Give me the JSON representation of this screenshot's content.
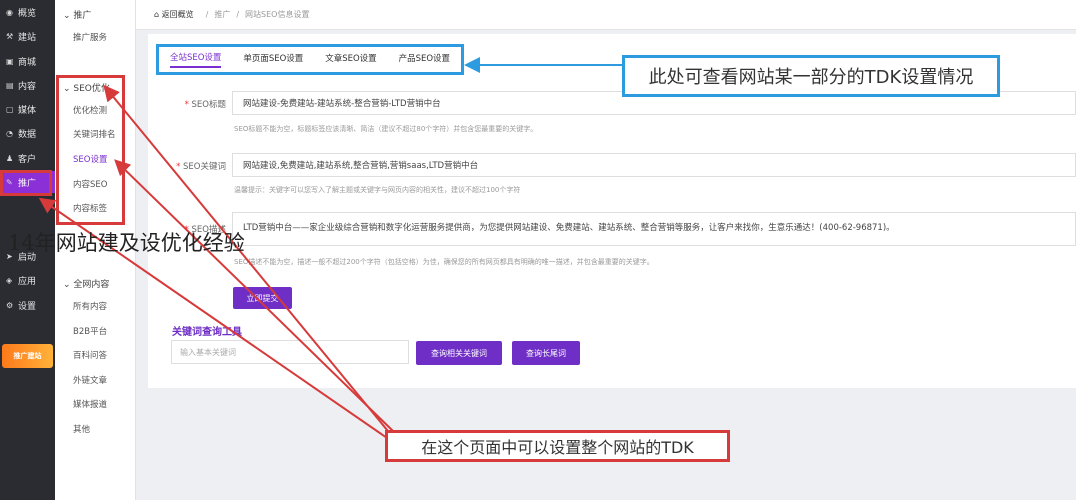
{
  "sidebar": {
    "items": [
      {
        "icon": "eye-icon",
        "glyph": "◉",
        "label": "概览"
      },
      {
        "icon": "build-icon",
        "glyph": "⚒",
        "label": "建站"
      },
      {
        "icon": "shop-icon",
        "glyph": "▣",
        "label": "商城"
      },
      {
        "icon": "content-icon",
        "glyph": "▤",
        "label": "内容"
      },
      {
        "icon": "media-icon",
        "glyph": "▢",
        "label": "媒体"
      },
      {
        "icon": "data-icon",
        "glyph": "◔",
        "label": "数据"
      },
      {
        "icon": "customer-icon",
        "glyph": "♟",
        "label": "客户"
      },
      {
        "icon": "promote-icon",
        "glyph": "✎",
        "label": "推广"
      },
      {
        "icon": "launch-icon",
        "glyph": "➤",
        "label": "启动"
      },
      {
        "icon": "apps-icon",
        "glyph": "◈",
        "label": "应用"
      },
      {
        "icon": "settings-icon",
        "glyph": "⚙",
        "label": "设置"
      }
    ],
    "promo_label": "推广建站"
  },
  "submenu": {
    "group1": "推广",
    "group1_items": [
      "推广服务"
    ],
    "group2": "SEO优化",
    "group2_items": [
      "优化检测",
      "关键词排名",
      "SEO设置",
      "内容SEO",
      "内容标签"
    ],
    "group3": "全网内容",
    "group3_items": [
      "所有内容",
      "B2B平台",
      "百科问答",
      "外链文章",
      "媒体报道",
      "其他"
    ]
  },
  "breadcrumb": {
    "back": "返回概览",
    "level1": "推广",
    "level2": "网站SEO信息设置"
  },
  "tabs": [
    "全站SEO设置",
    "单页面SEO设置",
    "文章SEO设置",
    "产品SEO设置"
  ],
  "form": {
    "title_label": "SEO标题",
    "title_value": "网站建设-免费建站-建站系统-整合营销-LTD营销中台",
    "title_hint": "SEO标题不能为空，标题标签应该清晰、简洁（建议不超过80个字符）并包含您最重要的关键字。",
    "keywords_label": "SEO关键词",
    "keywords_value": "网站建设,免费建站,建站系统,整合营销,营销saas,LTD营销中台",
    "keywords_hint": "温馨提示：关键字可以您写入了解主题或关键字与网页内容的相关性，建议不超过100个字符",
    "desc_label": "SEO描述",
    "desc_value": "LTD营销中台——家企业级综合营销和数字化运营服务提供商，为您提供网站建设、免费建站、建站系统、整合营销等服务，让客户来找你，生意乐通达！(400-62-96871)。",
    "desc_hint": "SEO描述不能为空，描述一般不超过200个字符（包括空格）为佳，确保您的所有网页都具有明确的唯一描述，并包含最重要的关键字。",
    "submit": "立即提交"
  },
  "keyword_tool": {
    "title": "关键词查询工具",
    "placeholder": "输入基本关键词",
    "related_button": "查询相关关键词",
    "longtail_button": "查询长尾词"
  },
  "annotations": {
    "callout_top": "此处可查看网站某一部分的TDK设置情况",
    "callout_bottom": "在这个页面中可以设置整个网站的TDK",
    "overlay_text": "14年网站建及设优化经验"
  },
  "colors": {
    "accent": "#6f2fc6",
    "callout_blue": "#2d9be0",
    "callout_red": "#d63a3a",
    "sidebar_bg": "#2a2c31"
  }
}
